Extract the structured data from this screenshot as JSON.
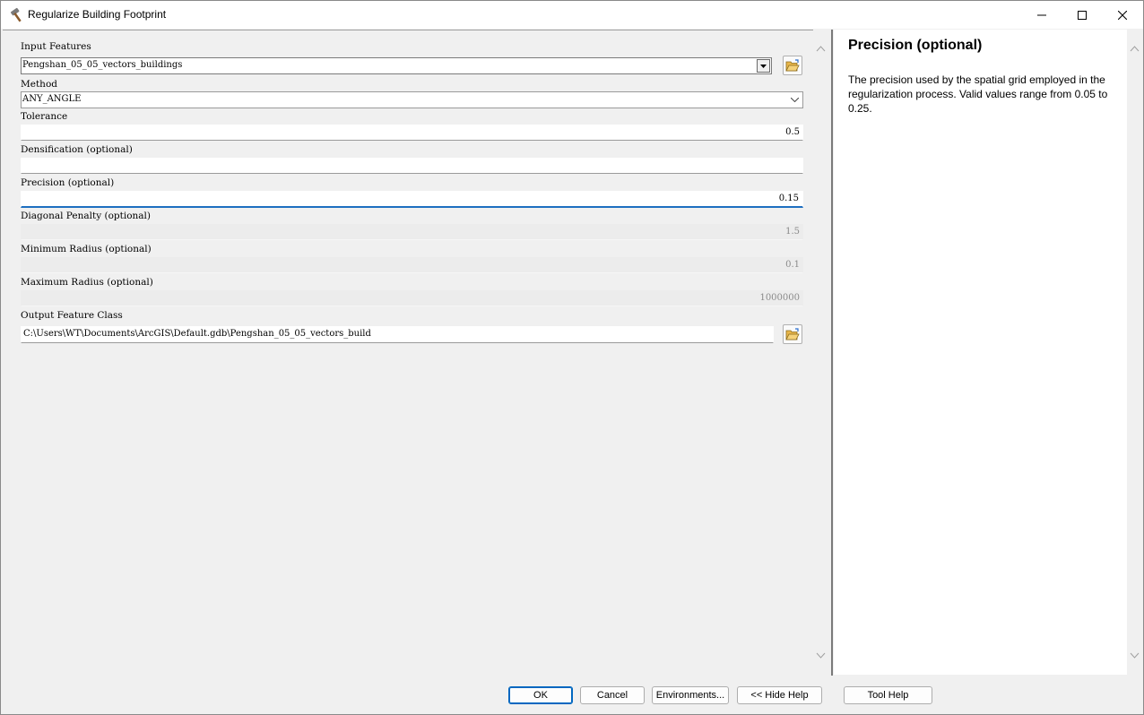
{
  "window": {
    "title": "Regularize Building Footprint",
    "icons": {
      "app": "hammer-icon",
      "minimize": "minimize-icon",
      "maximize": "maximize-icon",
      "close": "close-icon"
    }
  },
  "params": {
    "input_features": {
      "label": "Input Features",
      "value": "Pengshan_05_05_vectors_buildings"
    },
    "method": {
      "label": "Method",
      "value": "ANY_ANGLE"
    },
    "tolerance": {
      "label": "Tolerance",
      "value": "0.5"
    },
    "densification": {
      "label": "Densification (optional)",
      "value": ""
    },
    "precision": {
      "label": "Precision (optional)",
      "value": "0.15"
    },
    "diagonal_penalty": {
      "label": "Diagonal Penalty (optional)",
      "value": "1.5"
    },
    "minimum_radius": {
      "label": "Minimum Radius (optional)",
      "value": "0.1"
    },
    "maximum_radius": {
      "label": "Maximum Radius (optional)",
      "value": "1000000"
    },
    "output_feature_class": {
      "label": "Output Feature Class",
      "value": "C:\\Users\\WT\\Documents\\ArcGIS\\Default.gdb\\Pengshan_05_05_vectors_build"
    }
  },
  "help": {
    "title": "Precision (optional)",
    "body": "The precision used by the spatial grid employed in the regularization process. Valid values range from 0.05 to 0.25."
  },
  "buttons": {
    "ok": "OK",
    "cancel": "Cancel",
    "environments": "Environments...",
    "hide_help": "<< Hide Help",
    "tool_help": "Tool Help"
  },
  "colors": {
    "focus": "#1e6fc0",
    "default_button": "#0067c0",
    "folder": "#e8b64a"
  }
}
